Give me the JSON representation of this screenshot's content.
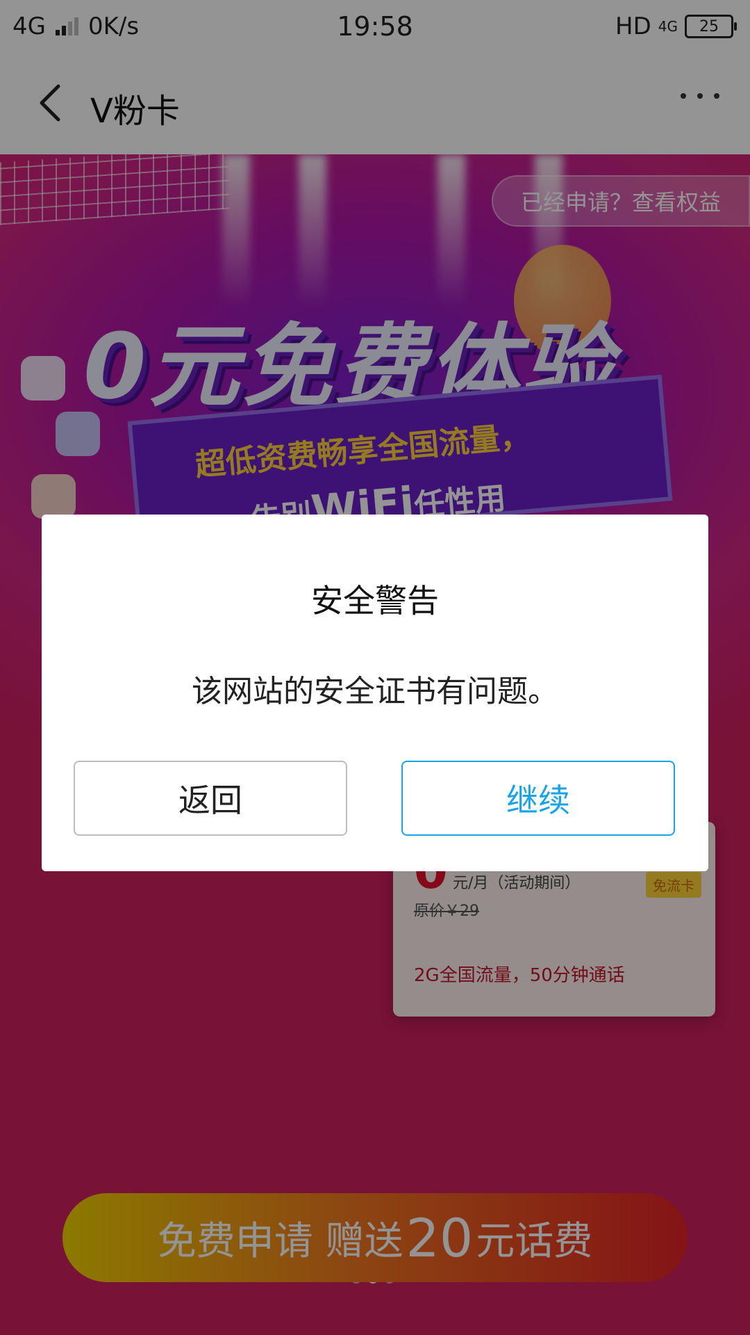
{
  "status_bar": {
    "network": "4G",
    "speed": "0K/s",
    "time": "19:58",
    "hd": "HD",
    "network_right": "4G",
    "battery": "25"
  },
  "header": {
    "title": "V粉卡",
    "back_icon": "chevron-left-icon",
    "more_icon": "more-horizontal-icon"
  },
  "banner": {
    "check_benefits": "已经申请？查看权益",
    "headline": "0元免费体验",
    "subline1": "超低资费畅享全国流量，",
    "subline2_prefix": "告别",
    "subline2_wifi": "WiFi",
    "subline2_suffix": "任性用",
    "card": {
      "price": "0",
      "unit": "元/月（活动期间）",
      "tag": "免流卡",
      "original": "原价￥29",
      "desc": "2G全国流量，50分钟通话"
    },
    "carousel": {
      "total": 3,
      "active_index": 1
    },
    "apply_button": {
      "part1": "免费申请 赠送",
      "amount": "20",
      "part2": "元话费"
    }
  },
  "dialog": {
    "title": "安全警告",
    "message": "该网站的安全证书有问题。",
    "back_label": "返回",
    "continue_label": "继续",
    "continue_color": "#18a3e6"
  }
}
